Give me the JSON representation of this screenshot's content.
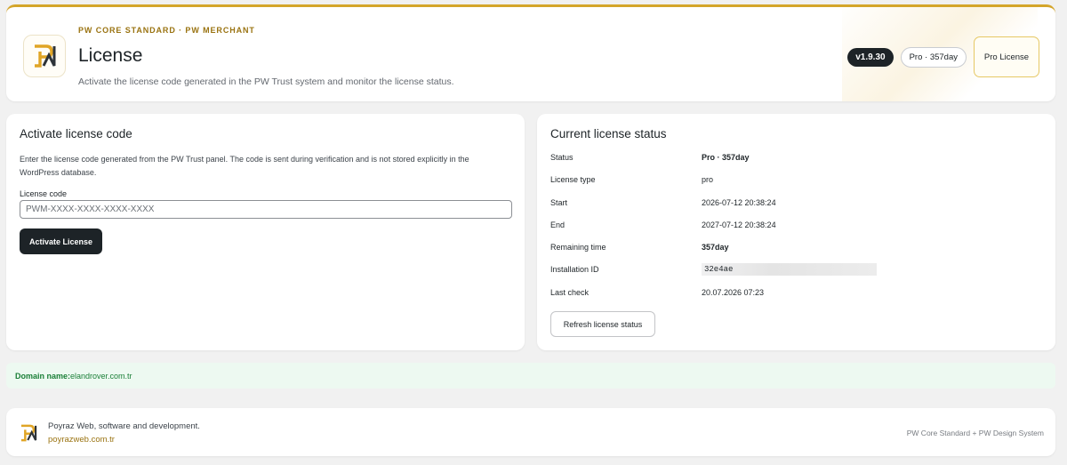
{
  "header": {
    "overline": "PW CORE STANDARD · PW MERCHANT",
    "title": "License",
    "subtitle": "Activate the license code generated in the PW Trust system and monitor the license status.",
    "version_badge": "v1.9.30",
    "plan_badge": "Pro · 357day",
    "pro_button": "Pro License"
  },
  "activate": {
    "heading": "Activate license code",
    "description": "Enter the license code generated from the PW Trust panel. The code is sent during verification and is not stored explicitly in the WordPress database.",
    "field_label": "License code",
    "placeholder": "PWM-XXXX-XXXX-XXXX-XXXX",
    "button": "Activate License"
  },
  "status": {
    "heading": "Current license status",
    "rows": [
      {
        "key": "Status",
        "value": "Pro · 357day"
      },
      {
        "key": "License type",
        "value": "pro"
      },
      {
        "key": "Start",
        "value": "2026-07-12 20:38:24"
      },
      {
        "key": "End",
        "value": "2027-07-12 20:38:24"
      },
      {
        "key": "Remaining time",
        "value": "357day"
      },
      {
        "key": "Installation ID",
        "value": "32e4ae"
      },
      {
        "key": "Last check",
        "value": "20.07.2026 07:23"
      }
    ],
    "refresh_button": "Refresh license status"
  },
  "domain": {
    "label": "Domain name:",
    "value": "elandrover.com.tr"
  },
  "footer": {
    "company": "Poyraz Web, software and development.",
    "link": "poyrazweb.com.tr",
    "right_text": "PW Core Standard + PW Design System"
  },
  "colors": {
    "accent": "#d4a52a",
    "dark": "#1d2327",
    "success_bg": "#edf9f1",
    "success_text": "#1a7f37"
  }
}
